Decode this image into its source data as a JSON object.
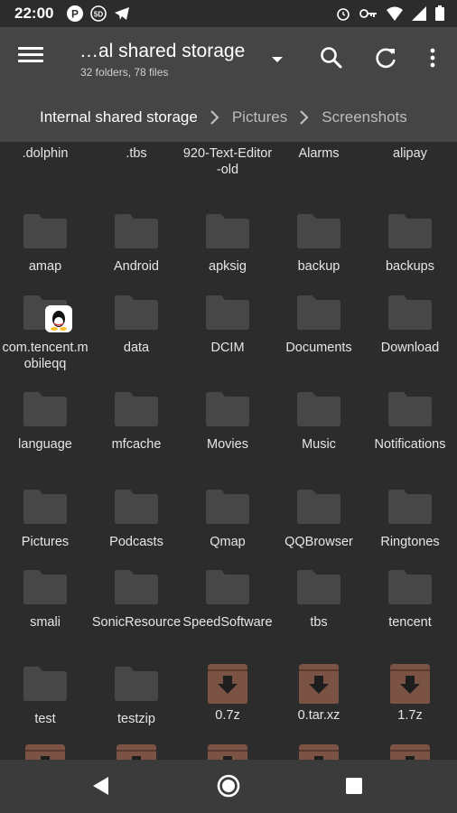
{
  "status_bar": {
    "time": "22:00",
    "left_icons": [
      "parking-icon",
      "5d-badge-icon",
      "telegram-icon"
    ],
    "right_icons": [
      "alarm-icon",
      "vpn-key-icon",
      "wifi-icon",
      "signal-icon",
      "battery-icon"
    ]
  },
  "appbar": {
    "title": "…al shared storage",
    "subtitle": "32 folders, 78 files",
    "actions": [
      "search-icon",
      "refresh-icon",
      "more-vert-icon"
    ]
  },
  "breadcrumb": [
    {
      "label": "Internal shared storage",
      "active": true
    },
    {
      "label": "Pictures",
      "active": false
    },
    {
      "label": "Screenshots",
      "active": false
    }
  ],
  "colors": {
    "background": "#2c2c2c",
    "appbar": "#454545",
    "folder": "#474747",
    "archive": "#7b5345",
    "navbar": "#3b3b3b"
  },
  "items": [
    {
      "name": ".dolphin",
      "type": "folder"
    },
    {
      "name": ".tbs",
      "type": "folder"
    },
    {
      "name": "920-Text-Editor-old",
      "type": "folder"
    },
    {
      "name": "Alarms",
      "type": "folder"
    },
    {
      "name": "alipay",
      "type": "folder"
    },
    {
      "name": "amap",
      "type": "folder"
    },
    {
      "name": "Android",
      "type": "folder"
    },
    {
      "name": "apksig",
      "type": "folder"
    },
    {
      "name": "backup",
      "type": "folder"
    },
    {
      "name": "backups",
      "type": "folder"
    },
    {
      "name": "com.tencent.mobileqq",
      "type": "folder-app"
    },
    {
      "name": "data",
      "type": "folder"
    },
    {
      "name": "DCIM",
      "type": "folder"
    },
    {
      "name": "Documents",
      "type": "folder"
    },
    {
      "name": "Download",
      "type": "folder"
    },
    {
      "name": "language",
      "type": "folder"
    },
    {
      "name": "mfcache",
      "type": "folder"
    },
    {
      "name": "Movies",
      "type": "folder"
    },
    {
      "name": "Music",
      "type": "folder"
    },
    {
      "name": "Notifications",
      "type": "folder"
    },
    {
      "name": "Pictures",
      "type": "folder"
    },
    {
      "name": "Podcasts",
      "type": "folder"
    },
    {
      "name": "Qmap",
      "type": "folder"
    },
    {
      "name": "QQBrowser",
      "type": "folder"
    },
    {
      "name": "Ringtones",
      "type": "folder"
    },
    {
      "name": "smali",
      "type": "folder"
    },
    {
      "name": "SonicResource",
      "type": "folder"
    },
    {
      "name": "SpeedSoftware",
      "type": "folder"
    },
    {
      "name": "tbs",
      "type": "folder"
    },
    {
      "name": "tencent",
      "type": "folder"
    },
    {
      "name": "test",
      "type": "folder"
    },
    {
      "name": "testzip",
      "type": "folder"
    },
    {
      "name": "0.7z",
      "type": "archive"
    },
    {
      "name": "0.tar.xz",
      "type": "archive"
    },
    {
      "name": "1.7z",
      "type": "archive"
    },
    {
      "name": "",
      "type": "archive"
    },
    {
      "name": "",
      "type": "archive"
    },
    {
      "name": "",
      "type": "archive"
    },
    {
      "name": "",
      "type": "archive"
    },
    {
      "name": "",
      "type": "archive"
    }
  ],
  "nav": [
    "back-icon",
    "home-icon",
    "recents-icon"
  ]
}
